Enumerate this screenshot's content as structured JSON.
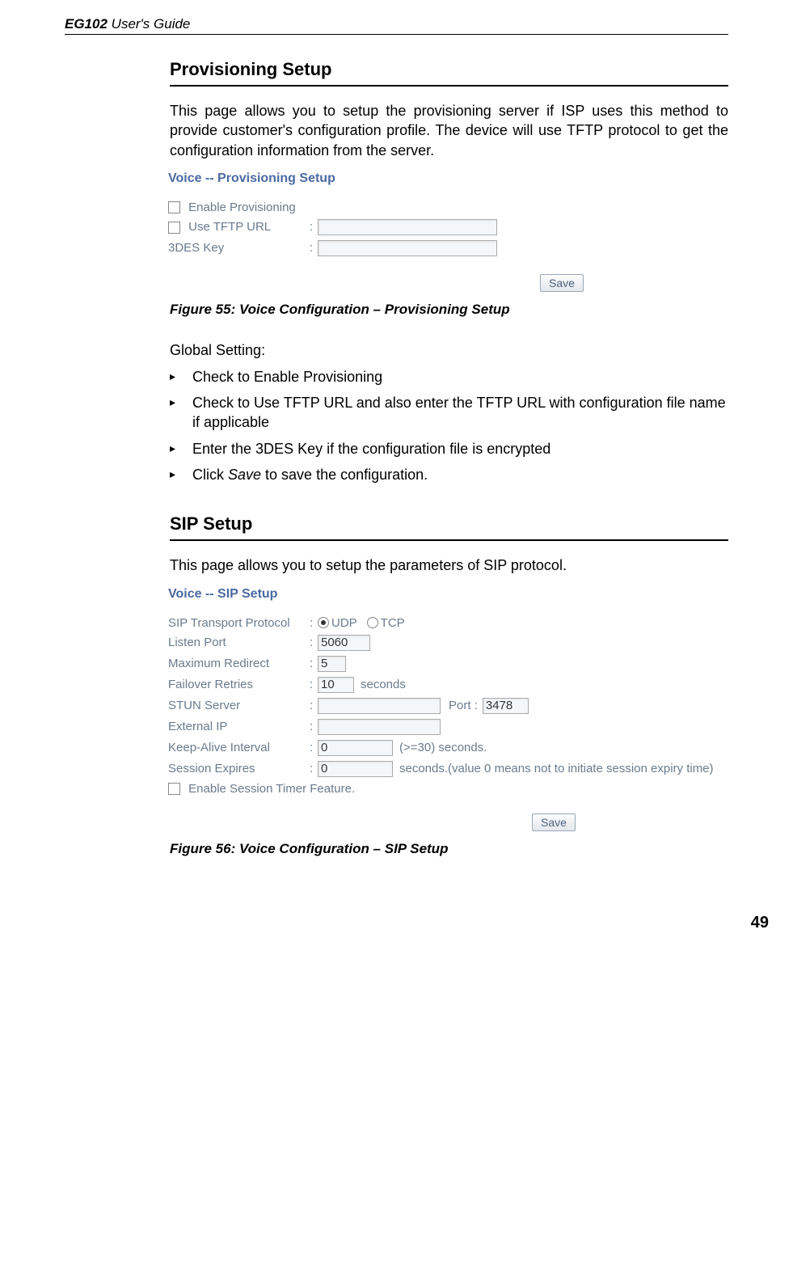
{
  "header": {
    "product": "EG102",
    "suffix": " User's Guide"
  },
  "section1": {
    "title": "Provisioning Setup",
    "intro": "This page allows you to setup the provisioning server if ISP uses this method to provide customer's configuration profile. The device will use TFTP protocol to get the configuration information from the server.",
    "fig": {
      "title": "Voice -- Provisioning Setup",
      "enable_label": "Enable Provisioning",
      "tftp_label": "Use TFTP URL",
      "des_label": "3DES Key",
      "save": "Save"
    },
    "caption": "Figure 55: Voice Configuration – Provisioning Setup",
    "global_label": "Global Setting:",
    "bullets": [
      "Check to Enable Provisioning",
      "Check to Use TFTP URL and also enter the TFTP URL with configuration file name if applicable",
      "Enter the 3DES Key if the configuration file is encrypted"
    ],
    "bullet_save_prefix": "Click ",
    "bullet_save_word": "Save",
    "bullet_save_suffix": " to save the configuration."
  },
  "section2": {
    "title": "SIP Setup",
    "intro": "This page allows you to setup the parameters of SIP protocol.",
    "fig": {
      "title": "Voice -- SIP Setup",
      "transport_label": "SIP Transport Protocol",
      "udp": "UDP",
      "tcp": "TCP",
      "listen_label": "Listen Port",
      "listen_value": "5060",
      "maxred_label": "Maximum Redirect",
      "maxred_value": "5",
      "failover_label": "Failover Retries",
      "failover_value": "10",
      "seconds": "seconds",
      "stun_label": "STUN Server",
      "port_label": "Port :",
      "port_value": "3478",
      "extip_label": "External IP",
      "keepalive_label": "Keep-Alive Interval",
      "keepalive_value": "0",
      "keepalive_note": "(>=30) seconds.",
      "session_label": "Session Expires",
      "session_value": "0",
      "session_note": "seconds.(value 0 means not to initiate session expiry time)",
      "enable_timer": "Enable Session Timer Feature.",
      "save": "Save"
    },
    "caption": "Figure 56: Voice Configuration – SIP Setup"
  },
  "page_number": "49"
}
